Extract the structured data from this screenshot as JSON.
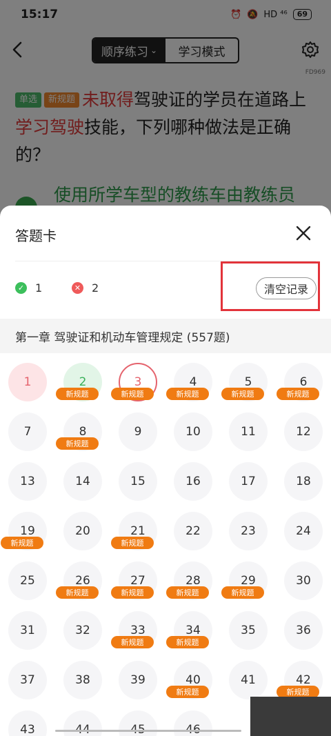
{
  "status": {
    "time": "15:17",
    "battery": "69",
    "net": "HD ⁴⁶"
  },
  "nav": {
    "tab_sequential": "顺序练习",
    "tab_study": "学习模式",
    "code": "FD969"
  },
  "question": {
    "tag_single": "单选",
    "tag_new": "新规题",
    "part1": "未取得",
    "part2": "驾驶证的学员在道路上",
    "part3": "学习驾驶",
    "part4": "技能，下列哪种做法是正确的？"
  },
  "option_a": {
    "text": "使用所学车型的教练车由教练员"
  },
  "sheet": {
    "title": "答题卡",
    "correct_count": "1",
    "wrong_count": "2",
    "clear_label": "清空记录",
    "chapter": "第一章  驾驶证和机动车管理规定 (557题)",
    "badge_label": "新规题"
  },
  "questions": [
    {
      "n": "1",
      "state": "wrong-soft",
      "badge": false
    },
    {
      "n": "2",
      "state": "correct",
      "badge": true
    },
    {
      "n": "3",
      "state": "current",
      "badge": true
    },
    {
      "n": "4",
      "state": "",
      "badge": true
    },
    {
      "n": "5",
      "state": "",
      "badge": true
    },
    {
      "n": "6",
      "state": "",
      "badge": true
    },
    {
      "n": "7",
      "state": "",
      "badge": false
    },
    {
      "n": "8",
      "state": "",
      "badge": true
    },
    {
      "n": "9",
      "state": "",
      "badge": false
    },
    {
      "n": "10",
      "state": "",
      "badge": false
    },
    {
      "n": "11",
      "state": "",
      "badge": false
    },
    {
      "n": "12",
      "state": "",
      "badge": false
    },
    {
      "n": "13",
      "state": "",
      "badge": false
    },
    {
      "n": "14",
      "state": "",
      "badge": false
    },
    {
      "n": "15",
      "state": "",
      "badge": false
    },
    {
      "n": "16",
      "state": "",
      "badge": false
    },
    {
      "n": "17",
      "state": "",
      "badge": false
    },
    {
      "n": "18",
      "state": "",
      "badge": false
    },
    {
      "n": "19",
      "state": "",
      "badge": true
    },
    {
      "n": "20",
      "state": "",
      "badge": false
    },
    {
      "n": "21",
      "state": "",
      "badge": true
    },
    {
      "n": "22",
      "state": "",
      "badge": false
    },
    {
      "n": "23",
      "state": "",
      "badge": false
    },
    {
      "n": "24",
      "state": "",
      "badge": false
    },
    {
      "n": "25",
      "state": "",
      "badge": false
    },
    {
      "n": "26",
      "state": "",
      "badge": true
    },
    {
      "n": "27",
      "state": "",
      "badge": true
    },
    {
      "n": "28",
      "state": "",
      "badge": true
    },
    {
      "n": "29",
      "state": "",
      "badge": true
    },
    {
      "n": "30",
      "state": "",
      "badge": false
    },
    {
      "n": "31",
      "state": "",
      "badge": false
    },
    {
      "n": "32",
      "state": "",
      "badge": false
    },
    {
      "n": "33",
      "state": "",
      "badge": true
    },
    {
      "n": "34",
      "state": "",
      "badge": true
    },
    {
      "n": "35",
      "state": "",
      "badge": false
    },
    {
      "n": "36",
      "state": "",
      "badge": false
    },
    {
      "n": "37",
      "state": "",
      "badge": false
    },
    {
      "n": "38",
      "state": "",
      "badge": false
    },
    {
      "n": "39",
      "state": "",
      "badge": false
    },
    {
      "n": "40",
      "state": "",
      "badge": true
    },
    {
      "n": "41",
      "state": "",
      "badge": false
    },
    {
      "n": "42",
      "state": "",
      "badge": true
    },
    {
      "n": "43",
      "state": "",
      "badge": false
    },
    {
      "n": "44",
      "state": "",
      "badge": false
    },
    {
      "n": "45",
      "state": "",
      "badge": false
    },
    {
      "n": "46",
      "state": "",
      "badge": false
    }
  ]
}
